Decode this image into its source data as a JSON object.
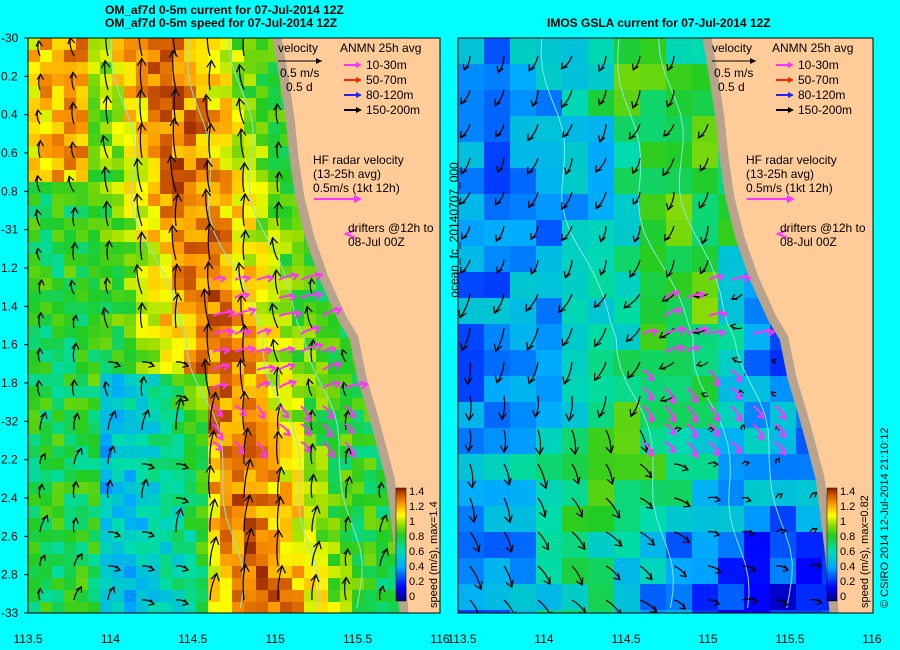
{
  "colors": {
    "page_bg": "#00ffff",
    "land": "#ffcc99",
    "coast": "#b9a38d",
    "iso": "#7fe8e8",
    "arrow": "#000000",
    "radar": "#ff33ff",
    "leg_10_30": "#ff33ff",
    "leg_50_70": "#ff2200",
    "leg_80_120": "#2222ff",
    "leg_150_200": "#000000"
  },
  "left": {
    "title_line1": "OM_af7d 0-5m current for 07-Jul-2014 12Z",
    "title_line2": "OM_af7d 0-5m speed for 07-Jul-2014 12Z",
    "colorbar_label": "speed (m/s), max=1.4",
    "colorbar_max": 1.4
  },
  "right": {
    "title": "IMOS GSLA current for 07-Jul-2014 12Z",
    "side_label": "ocean_fc_20140707_000",
    "colorbar_label": "speed (m/s), max=0.82",
    "colorbar_max": 1.4
  },
  "legend": {
    "velocity_title": "velocity",
    "velocity_scale": "0.5 m/s",
    "velocity_time": "0.5 d",
    "anmn_title": "ANMN 25h avg",
    "items": [
      "10-30m",
      "50-70m",
      "80-120m",
      "150-200m"
    ],
    "hf_title": "HF radar velocity",
    "hf_avg": "(13-25h avg)",
    "hf_scale": "0.5m/s (1kt 12h)",
    "drifters_line1": "drifters @12h to",
    "drifters_line2": "08-Jul 00Z"
  },
  "colorbar_ticks": [
    "1.4",
    "1.2",
    "1",
    "0.8",
    "0.6",
    "0.4",
    "0.2",
    "0"
  ],
  "y_axis_labels": [
    "-30",
    "0.2",
    "0.4",
    "0.6",
    "0.8",
    "-31",
    "1.2",
    "1.4",
    "1.6",
    "1.8",
    "-32",
    "2.2",
    "2.4",
    "2.6",
    "2.8",
    "-33"
  ],
  "left_x_labels": [
    "113.5",
    "114",
    "114.5",
    "115",
    "115.5",
    "116"
  ],
  "right_x_labels": [
    "113.5",
    "114",
    "114.5",
    "115",
    "115.5",
    "116"
  ],
  "credit": "© CSIRO 2014   12-Jul-2014 21:10:12"
}
